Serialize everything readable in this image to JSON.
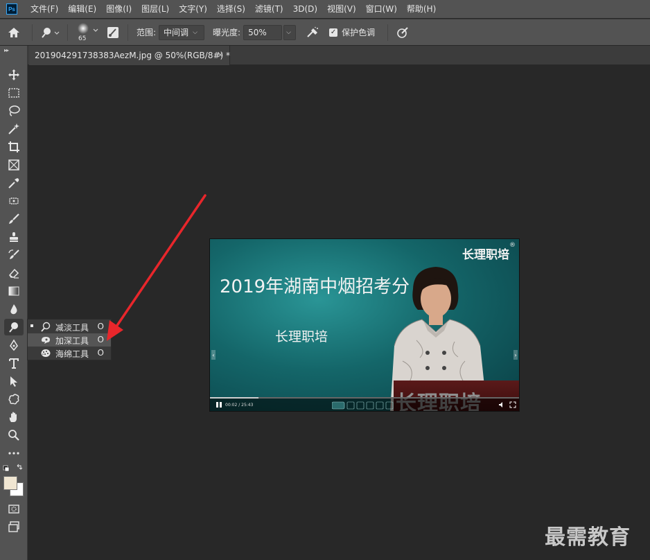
{
  "menu": {
    "logo": "Ps",
    "items": [
      "文件(F)",
      "编辑(E)",
      "图像(I)",
      "图层(L)",
      "文字(Y)",
      "选择(S)",
      "滤镜(T)",
      "3D(D)",
      "视图(V)",
      "窗口(W)",
      "帮助(H)"
    ]
  },
  "options": {
    "brush_size": "65",
    "range_label": "范围:",
    "range_value": "中间调",
    "exposure_label": "曝光度:",
    "exposure_value": "50%",
    "protect_tones_label": "保护色调",
    "protect_tones_checked": true
  },
  "document": {
    "tab_title": "201904291738383AezM.jpg @ 50%(RGB/8#) *",
    "close": "×"
  },
  "flyout": {
    "items": [
      {
        "label": "减淡工具",
        "key": "O",
        "selected": true
      },
      {
        "label": "加深工具",
        "key": "O",
        "selected": false
      },
      {
        "label": "海绵工具",
        "key": "O",
        "selected": false
      }
    ]
  },
  "canvas": {
    "brand": "长理职培",
    "reg": "®",
    "title": "2019年湖南中烟招考分",
    "subtitle": "长理职培",
    "podium_text": "长理职培",
    "time": "00:02 / 25:43"
  },
  "watermark": "最需教育",
  "colors": {
    "accent": "#31a8ff",
    "arrow": "#e8262b",
    "foreground": "#f0e6d2",
    "background": "#ffffff"
  }
}
